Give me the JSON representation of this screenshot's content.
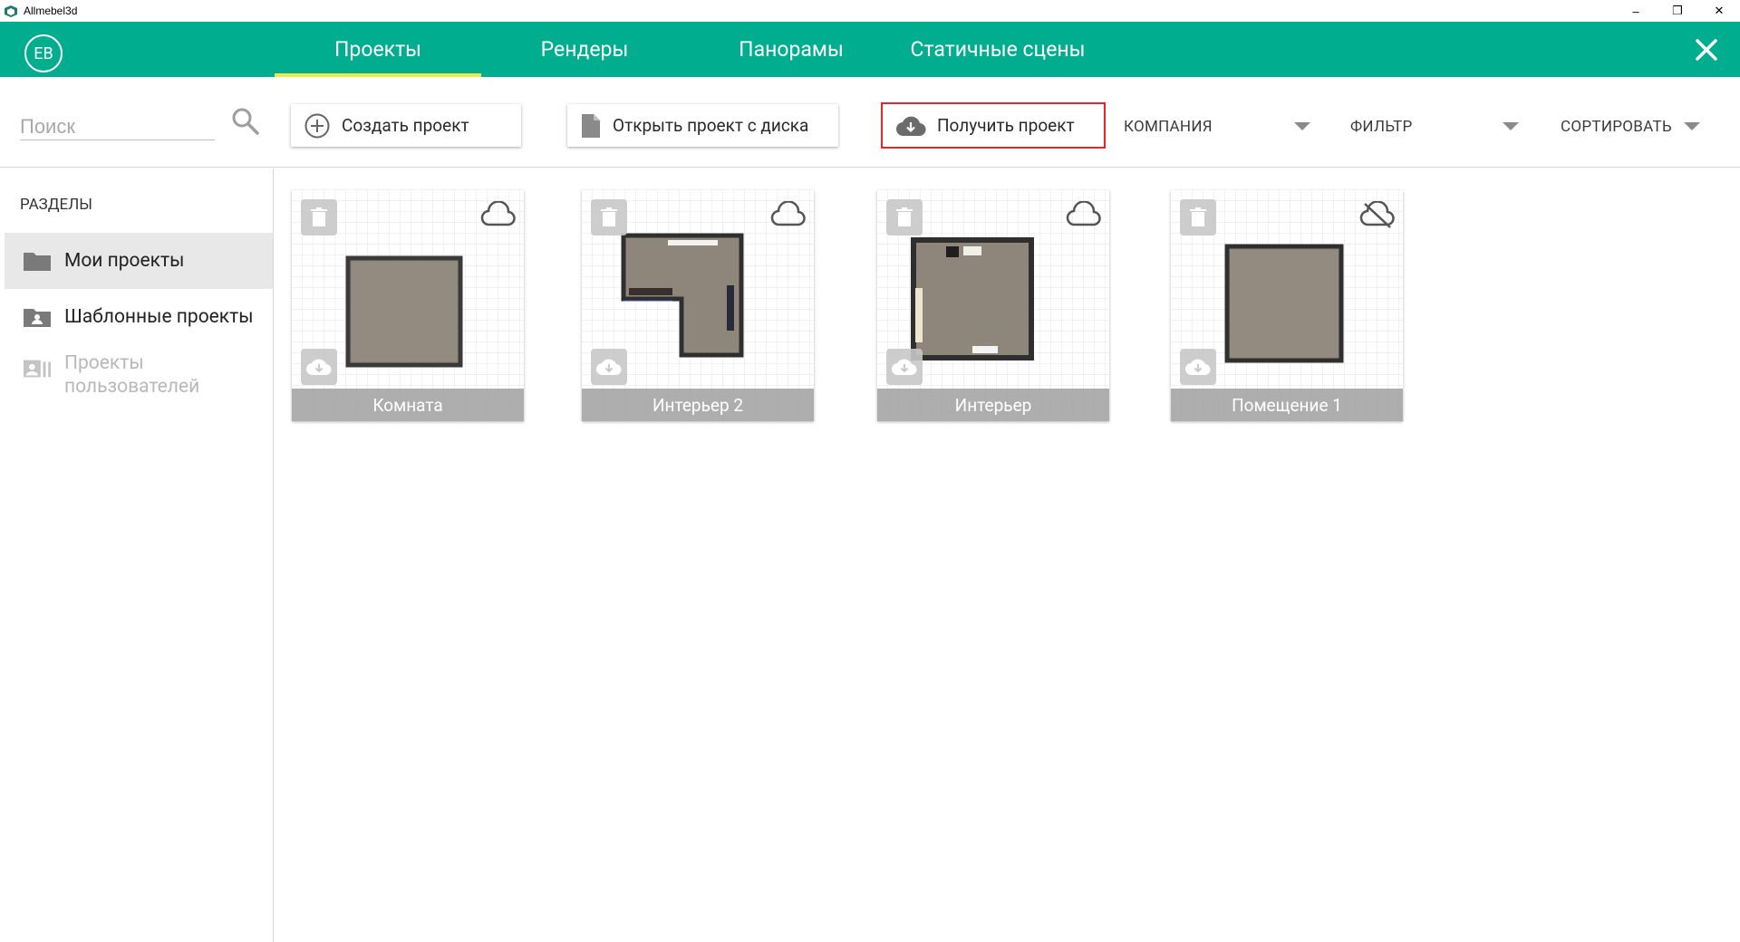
{
  "window": {
    "title": "Allmebel3d",
    "min": "–",
    "max": "❐",
    "close": "✕"
  },
  "header": {
    "avatar": "EB",
    "tabs": [
      {
        "label": "Проекты",
        "active": true
      },
      {
        "label": "Рендеры",
        "active": false
      },
      {
        "label": "Панорамы",
        "active": false
      },
      {
        "label": "Статичные сцены",
        "active": false
      }
    ],
    "accent": "#00ad8f",
    "tab_indicator": "#f0e74b"
  },
  "toolbar": {
    "search_placeholder": "Поиск",
    "create_label": "Создать проект",
    "open_label": "Открыть проект с диска",
    "get_label": "Получить проект",
    "company_label": "КОМПАНИЯ",
    "filter_label": "ФИЛЬТР",
    "sort_label": "СОРТИРОВАТЬ"
  },
  "sidebar": {
    "title": "РАЗДЕЛЫ",
    "items": [
      {
        "label": "Мои проекты",
        "icon": "folder-icon",
        "active": true
      },
      {
        "label": "Шаблонные проекты",
        "icon": "template-folder-icon",
        "active": false
      },
      {
        "label": "Проекты пользователей",
        "icon": "user-projects-icon",
        "active": false,
        "disabled": true
      }
    ]
  },
  "projects": [
    {
      "name": "Комната",
      "cloud": "cloud-icon"
    },
    {
      "name": "Интерьер 2",
      "cloud": "cloud-icon"
    },
    {
      "name": "Интерьер",
      "cloud": "cloud-icon"
    },
    {
      "name": "Помещение 1",
      "cloud": "cloud-off-icon"
    }
  ]
}
